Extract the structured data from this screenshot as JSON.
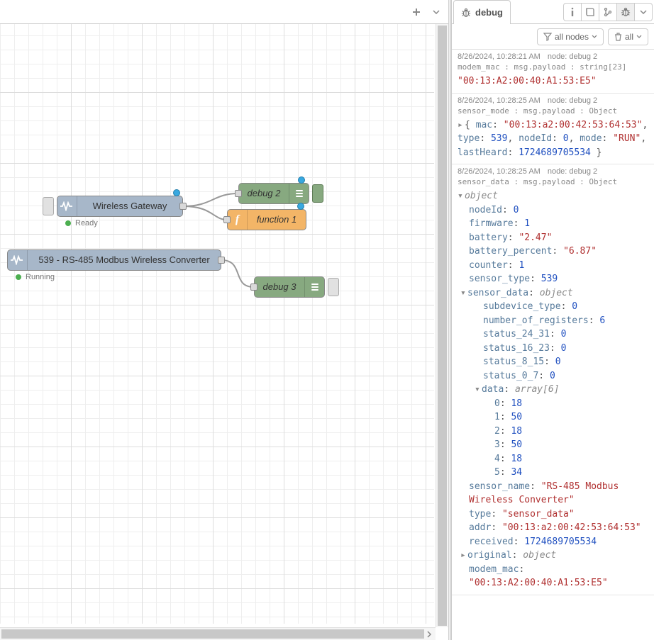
{
  "editor_header": {
    "add_tab_tooltip": "Add flow",
    "menu_tooltip": "More"
  },
  "nodes": {
    "gateway": {
      "label": "Wireless Gateway",
      "status": "Ready"
    },
    "inject": {
      "label": "539 - RS-485 Modbus Wireless Converter",
      "status": "Running"
    },
    "debug2": {
      "label": "debug 2"
    },
    "func1": {
      "label": "function 1"
    },
    "debug3": {
      "label": "debug 3"
    }
  },
  "sidebar": {
    "tab_title": "debug",
    "btn_filter": "all nodes",
    "btn_clear": "all"
  },
  "messages": [
    {
      "ts": "8/26/2024, 10:28:21 AM",
      "node": "node: debug 2",
      "topic": "modem_mac : msg.payload : string[23]",
      "string_value": "\"00:13:A2:00:40:A1:53:E5\""
    },
    {
      "ts": "8/26/2024, 10:28:25 AM",
      "node": "node: debug 2",
      "topic": "sensor_mode : msg.payload : Object",
      "collapsed_object": {
        "mac": "\"00:13:a2:00:42:53:64:53\"",
        "type": "539",
        "nodeId": "0",
        "mode": "\"RUN\"",
        "lastHeard": "1724689705534"
      }
    },
    {
      "ts": "8/26/2024, 10:28:25 AM",
      "node": "node: debug 2",
      "topic": "sensor_data : msg.payload : Object",
      "obj_label": "object",
      "fields": {
        "nodeId": "0",
        "firmware": "1",
        "battery": "\"2.47\"",
        "battery_percent": "\"6.87\"",
        "counter": "1",
        "sensor_type": "539"
      },
      "sensor_data_label": "sensor_data",
      "sensor_data_type": "object",
      "sensor_data": {
        "subdevice_type": "0",
        "number_of_registers": "6",
        "status_24_31": "0",
        "status_16_23": "0",
        "status_8_15": "0",
        "status_0_7": "0"
      },
      "data_label": "data",
      "data_type": "array[6]",
      "data_array": [
        "18",
        "50",
        "18",
        "50",
        "18",
        "34"
      ],
      "tail_fields": {
        "sensor_name": "\"RS-485 Modbus Wireless Converter\"",
        "type": "\"sensor_data\"",
        "addr": "\"00:13:a2:00:42:53:64:53\"",
        "received": "1724689705534"
      },
      "original_label": "original",
      "original_type": "object",
      "modem_mac_key": "modem_mac",
      "modem_mac_val": "\"00:13:A2:00:40:A1:53:E5\""
    }
  ]
}
